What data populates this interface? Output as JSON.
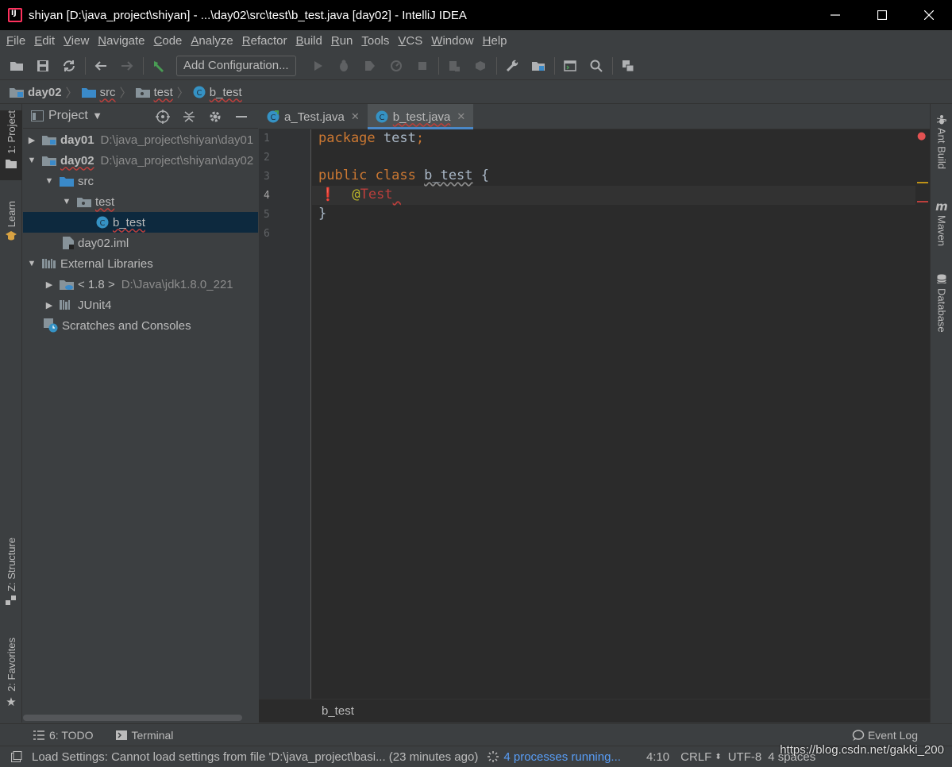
{
  "window": {
    "title": "shiyan [D:\\java_project\\shiyan] - ...\\day02\\src\\test\\b_test.java [day02] - IntelliJ IDEA"
  },
  "menu": [
    "File",
    "Edit",
    "View",
    "Navigate",
    "Code",
    "Analyze",
    "Refactor",
    "Build",
    "Run",
    "Tools",
    "VCS",
    "Window",
    "Help"
  ],
  "toolbar": {
    "run_config_label": "Add Configuration..."
  },
  "breadcrumbs": [
    "day02",
    "src",
    "test",
    "b_test"
  ],
  "left_strip": {
    "project": "1: Project",
    "learn": "Learn",
    "structure": "Z: Structure",
    "favorites": "2: Favorites"
  },
  "right_strip": {
    "ant": "Ant Build",
    "maven": "Maven",
    "database": "Database"
  },
  "project_panel": {
    "title": "Project",
    "tree": [
      {
        "label": "day01",
        "path": "D:\\java_project\\shiyan\\day01"
      },
      {
        "label": "day02",
        "path": "D:\\java_project\\shiyan\\day02"
      },
      {
        "label": "src"
      },
      {
        "label": "test"
      },
      {
        "label": "b_test"
      },
      {
        "label": "day02.iml"
      },
      {
        "label": "External Libraries"
      },
      {
        "label": "< 1.8 >",
        "path": "D:\\Java\\jdk1.8.0_221"
      },
      {
        "label": "JUnit4"
      },
      {
        "label": "Scratches and Consoles"
      }
    ]
  },
  "editor": {
    "tabs": [
      {
        "label": "a_Test.java"
      },
      {
        "label": "b_test.java"
      }
    ],
    "line_numbers": [
      "1",
      "2",
      "3",
      "4",
      "5",
      "6"
    ],
    "code": {
      "l1_kw": "package",
      "l1_rest": " test",
      "l1_semi": ";",
      "l3_kw1": "public",
      "l3_kw2": "class",
      "l3_name": "b_test",
      "l3_brace": " {",
      "l4_at": "@",
      "l4_ann": "Test",
      "l5": "}"
    },
    "bottom_breadcrumb": "b_test"
  },
  "bottom_tools": {
    "todo": "6: TODO",
    "terminal": "Terminal",
    "event_log": "Event Log"
  },
  "status": {
    "message": "Load Settings: Cannot load settings from file 'D:\\java_project\\basi... (23 minutes ago)",
    "processes": "4 processes running...",
    "position": "4:10",
    "line_sep": "CRLF",
    "encoding": "UTF-8",
    "indent": "4 spaces"
  },
  "watermark": "https://blog.csdn.net/gakki_200",
  "colors": {
    "accent": "#4a88c7",
    "error": "#bc3f3c",
    "keyword": "#cc7832",
    "folder": "#3a8ac9"
  }
}
